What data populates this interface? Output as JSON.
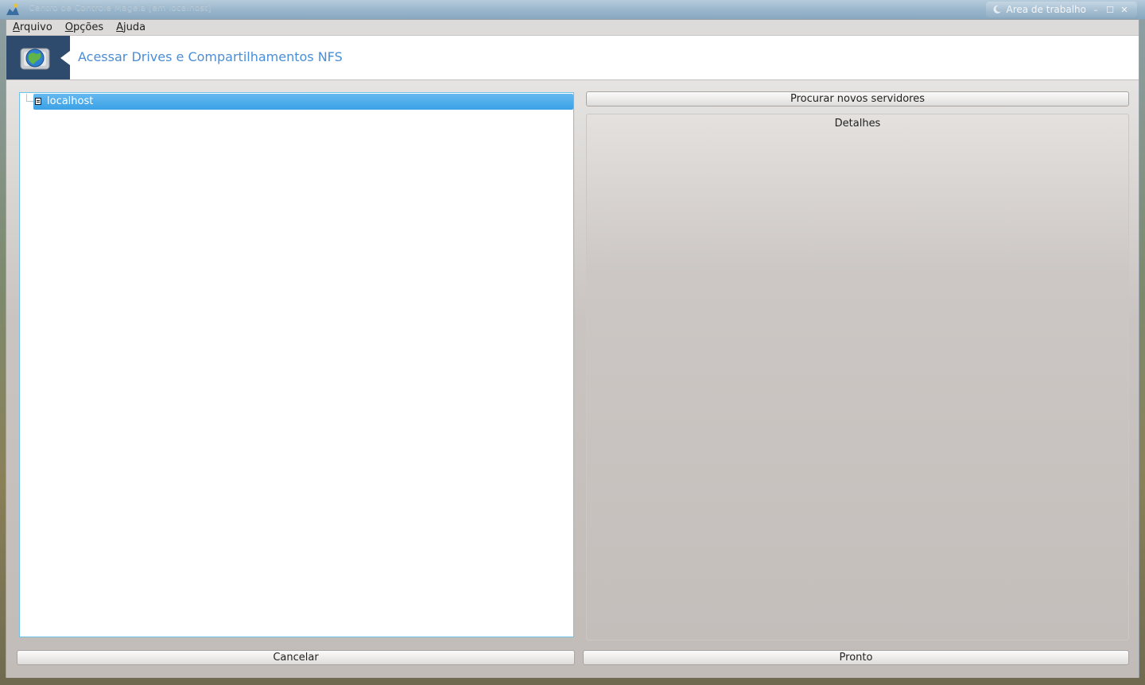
{
  "window": {
    "title": "Centro de Controle Mageia  [em localhost]",
    "desktop_label": "Area de trabalho",
    "controls": [
      "–",
      "☐",
      "✕"
    ]
  },
  "menubar": {
    "items": [
      {
        "accel": "A",
        "rest": "rquivo"
      },
      {
        "accel": "O",
        "rest": "pções"
      },
      {
        "accel": "A",
        "rest": "juda"
      }
    ]
  },
  "banner": {
    "title": "Acessar Drives e Compartilhamentos NFS",
    "icon": "nfs-drive-globe-icon"
  },
  "tree": {
    "items": [
      {
        "label": "localhost",
        "icon": "server-icon",
        "selected": true
      }
    ]
  },
  "buttons": {
    "search": "Procurar novos servidores",
    "cancel": "Cancelar",
    "ok": "Pronto"
  },
  "details": {
    "title": "Detalhes"
  },
  "colors": {
    "accent": "#3aa1e6",
    "banner_title": "#4a8ed6",
    "banner_logo_bg": "#2e4a6c"
  }
}
